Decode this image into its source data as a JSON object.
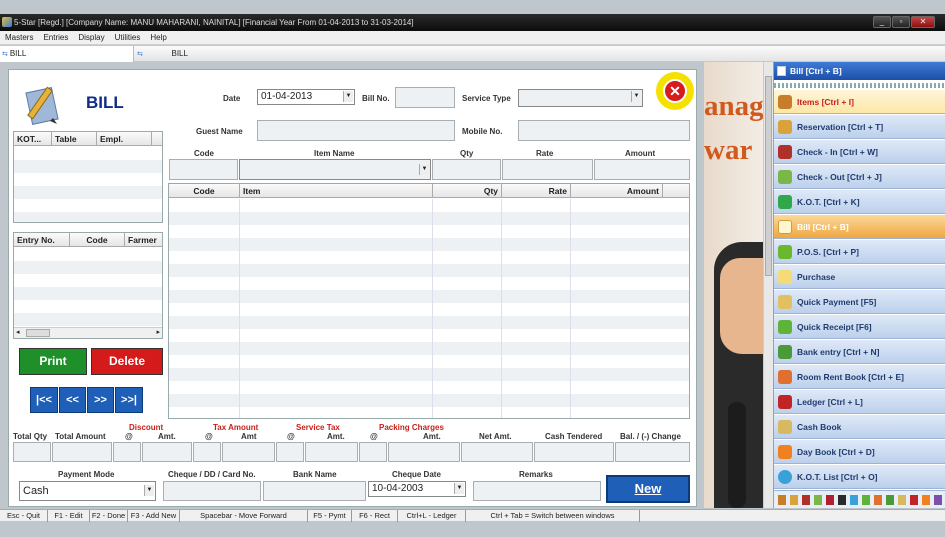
{
  "window": {
    "title": "5-Star [Regd.] [Company Name: MANU MAHARANI, NAINITAL] [Financial Year From 01-04-2013 to 31-03-2014]"
  },
  "menu": [
    "Masters",
    "Entries",
    "Display",
    "Utilities",
    "Help"
  ],
  "tabs": [
    "BILL",
    "BILL"
  ],
  "header": {
    "title": "BILL",
    "date_label": "Date",
    "date_value": "01-04-2013",
    "billno_label": "Bill No.",
    "service_type_label": "Service Type",
    "guest_name_label": "Guest Name",
    "mobile_label": "Mobile No."
  },
  "item_entry": {
    "headers": [
      "Code",
      "Item Name",
      "Qty",
      "Rate",
      "Amount"
    ]
  },
  "kot_grid": {
    "headers": [
      "KOT...",
      "Table",
      "Empl."
    ]
  },
  "entry_grid": {
    "headers": [
      "Entry No.",
      "Code",
      "Farmer"
    ]
  },
  "items_grid": {
    "headers": [
      "Code",
      "Item",
      "Qty",
      "Rate",
      "Amount"
    ]
  },
  "buttons": {
    "print": "Print",
    "delete": "Delete",
    "first": "|<<",
    "prev": "<<",
    "next": ">>",
    "last": ">>|",
    "new": "New"
  },
  "totals": {
    "labels": [
      "Total Qty",
      "Total Amount",
      "Discount",
      "@",
      "Amt.",
      "Tax Amount",
      "@",
      "Amt",
      "Service Tax",
      "@",
      "Amt.",
      "Packing Charges",
      "@",
      "Amt.",
      "Net Amt.",
      "Cash Tendered",
      "Bal. / (-) Change"
    ]
  },
  "payment": {
    "mode_label": "Payment Mode",
    "mode_value": "Cash",
    "cheque_label": "Cheque / DD / Card No.",
    "bank_label": "Bank Name",
    "cheque_date_label": "Cheque Date",
    "cheque_date_value": "10-04-2003",
    "remarks_label": "Remarks"
  },
  "ad": {
    "line1": "anag",
    "line2": "war"
  },
  "sidebar": {
    "header": "Bill [Ctrl + B]",
    "items": [
      "Items [Ctrl + I]",
      "Reservation [Ctrl + T]",
      "Check - In [Ctrl + W]",
      "Check - Out [Ctrl + J]",
      "K.O.T. [Ctrl + K]",
      "Bill [Ctrl + B]",
      "P.O.S. [Ctrl + P]",
      "Purchase",
      "Quick Payment [F5]",
      "Quick Receipt [F6]",
      "Bank entry [Ctrl + N]",
      "Room Rent Book [Ctrl + E]",
      "Ledger [Ctrl + L]",
      "Cash Book",
      "Day Book [Ctrl + D]",
      "K.O.T. List [Ctrl + O]"
    ]
  },
  "status": [
    "Esc - Quit",
    "F1 - Edit",
    "F2 - Done",
    "F3 - Add New",
    "Spacebar - Move Forward",
    "F5 - Pymt",
    "F6 - Rect",
    "Ctrl+L - Ledger",
    "Ctrl + Tab = Switch between windows"
  ],
  "colors": {
    "print": "#1f8f2a",
    "delete": "#d41a1a",
    "nav": "#1f5fb8",
    "sidebar_active": "#f0a640",
    "sidebar_item": "#c9d9f0"
  }
}
